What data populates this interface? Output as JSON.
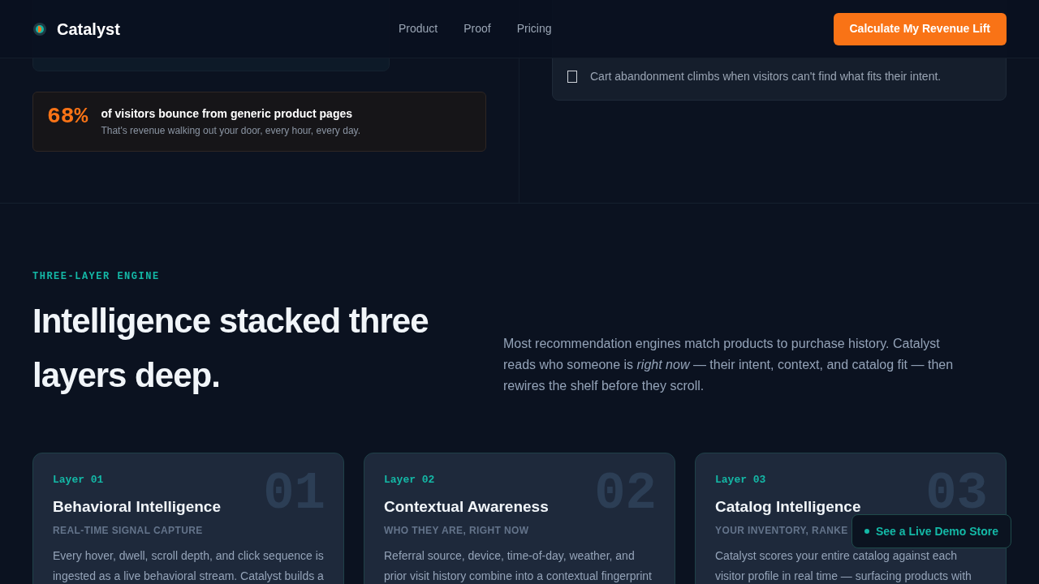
{
  "nav": {
    "brand": "Catalyst",
    "links": [
      "Product",
      "Proof",
      "Pricing"
    ],
    "cta": "Calculate My Revenue Lift"
  },
  "hero": {
    "pain_points": [
      "Cart abandonment climbs when visitors can't find what fits their intent."
    ],
    "stat": {
      "value": "68%",
      "headline": "of visitors bounce from generic product pages",
      "subline": "That's revenue walking out your door, every hour, every day."
    }
  },
  "engine": {
    "eyebrow": "THREE-LAYER ENGINE",
    "heading": "Intelligence stacked three layers deep.",
    "intro": "Most recommendation engines match products to purchase history. Catalyst reads who someone is *right now* — their intent, context, and catalog fit — then rewires the shelf before they scroll.",
    "layers": [
      {
        "tag": "Layer 01",
        "number": "01",
        "title": "Behavioral Intelligence",
        "subtitle": "REAL-TIME SIGNAL CAPTURE",
        "body": "Every hover, dwell, scroll depth, and click sequence is ingested as a live behavioral stream. Catalyst builds a"
      },
      {
        "tag": "Layer 02",
        "number": "02",
        "title": "Contextual Awareness",
        "subtitle": "WHO THEY ARE, RIGHT NOW",
        "body": "Referral source, device, time-of-day, weather, and prior visit history combine into a contextual fingerprint"
      },
      {
        "tag": "Layer 03",
        "number": "03",
        "title": "Catalog Intelligence",
        "subtitle": "YOUR INVENTORY, RANKE",
        "body": "Catalyst scores your entire catalog against each visitor profile in real time — surfacing products with"
      }
    ]
  },
  "floating_button": "See a Live Demo Store"
}
